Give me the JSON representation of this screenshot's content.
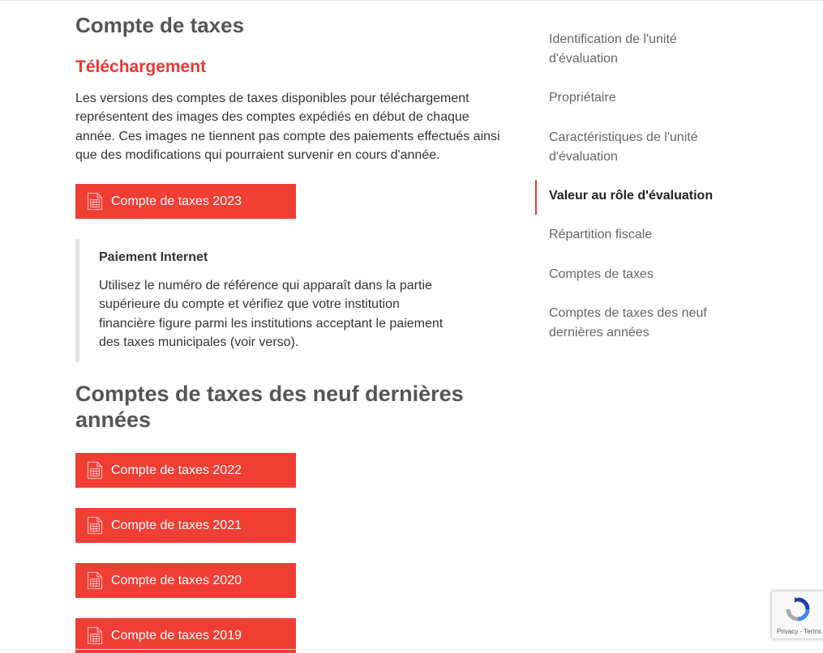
{
  "main": {
    "title": "Compte de taxes",
    "download_heading": "Téléchargement",
    "intro": "Les versions des comptes de taxes disponibles pour téléchargement représentent des images des comptes expédiés en début de chaque année. Ces images ne tiennent pas compte des paiements effectués ainsi que des modifications qui pourraient survenir en cours d'année.",
    "current_bill": {
      "label": "Compte de taxes 2023",
      "icon": "pdf-document-icon"
    },
    "payment_notice": {
      "title": "Paiement Internet",
      "text": "Utilisez le numéro de référence qui apparaît dans la partie supérieure du compte et vérifiez que votre institution financière figure parmi les institutions acceptant le paiement des taxes municipales (voir verso)."
    },
    "past_heading": "Comptes de taxes des neuf dernières années",
    "past_bills": [
      {
        "label": "Compte de taxes 2022",
        "icon": "pdf-document-icon"
      },
      {
        "label": "Compte de taxes 2021",
        "icon": "pdf-document-icon"
      },
      {
        "label": "Compte de taxes 2020",
        "icon": "pdf-document-icon"
      },
      {
        "label": "Compte de taxes 2019",
        "icon": "pdf-document-icon"
      }
    ]
  },
  "sidebar": {
    "active_index": 3,
    "items": [
      {
        "label": "Identification de l'unité d'évaluation"
      },
      {
        "label": "Propriétaire"
      },
      {
        "label": "Caractéristiques de l'unité d'évaluation"
      },
      {
        "label": "Valeur au rôle d'évaluation"
      },
      {
        "label": "Répartition fiscale"
      },
      {
        "label": "Comptes de taxes"
      },
      {
        "label": "Comptes de taxes des neuf dernières années"
      }
    ]
  },
  "recaptcha": {
    "links": "Privacy - Terms"
  },
  "colors": {
    "accent_red": "#f03e35",
    "heading_red": "#e53935",
    "heading_gray": "#555555",
    "text": "#333333",
    "nav_text": "#666666"
  }
}
